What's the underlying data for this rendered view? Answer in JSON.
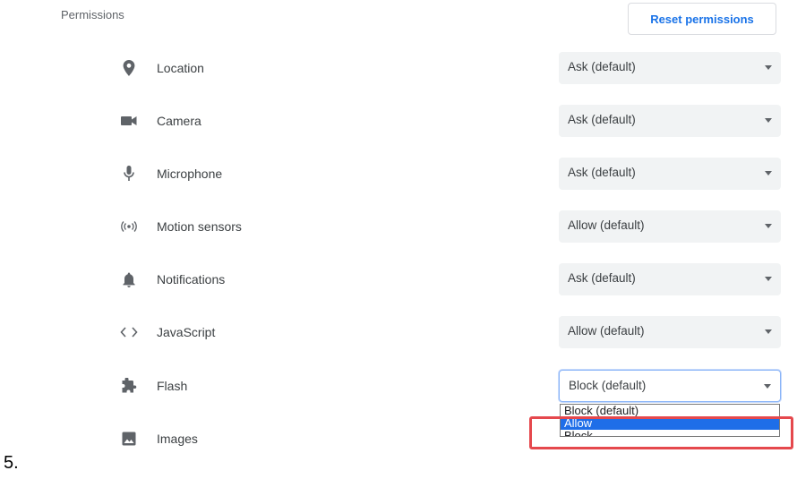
{
  "section": {
    "title": "Permissions",
    "reset_label": "Reset permissions"
  },
  "permissions": [
    {
      "label": "Location",
      "icon": "location-pin-icon",
      "value": "Ask (default)"
    },
    {
      "label": "Camera",
      "icon": "camera-icon",
      "value": "Ask (default)"
    },
    {
      "label": "Microphone",
      "icon": "microphone-icon",
      "value": "Ask (default)"
    },
    {
      "label": "Motion sensors",
      "icon": "motion-sensors-icon",
      "value": "Allow (default)"
    },
    {
      "label": "Notifications",
      "icon": "bell-icon",
      "value": "Ask (default)"
    },
    {
      "label": "JavaScript",
      "icon": "code-brackets-icon",
      "value": "Allow (default)"
    },
    {
      "label": "Flash",
      "icon": "puzzle-piece-icon",
      "value": "Block (default)"
    },
    {
      "label": "Images",
      "icon": "image-icon"
    }
  ],
  "dropdown": {
    "options": [
      "Block (default)",
      "Allow",
      "Block"
    ],
    "selected": "Allow"
  },
  "step_label": "5.",
  "colors": {
    "accent": "#1a73e8",
    "highlight_border": "#e5484d",
    "selected_option_bg": "#1e6ee8"
  }
}
